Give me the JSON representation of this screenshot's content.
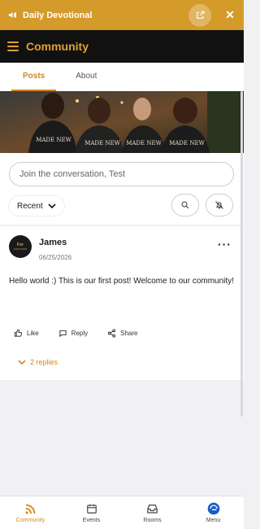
{
  "topbar": {
    "title": "Daily Devotional"
  },
  "appbar": {
    "title": "Community"
  },
  "tabs": [
    {
      "label": "Posts",
      "active": true
    },
    {
      "label": "About",
      "active": false
    }
  ],
  "hero": {
    "shirt_text": "MADE NEW"
  },
  "composer": {
    "placeholder": "Join the conversation, Test",
    "sort_label": "Recent"
  },
  "post": {
    "author": "James",
    "date": "06/25/2026",
    "avatar_text_top": "For",
    "avatar_text_mid": "FORTUVEN",
    "body": "Hello world :) This is our first post! Welcome to our community!",
    "actions": {
      "like": "Like",
      "reply": "Reply",
      "share": "Share"
    },
    "replies": "2 replies"
  },
  "bottom_nav": [
    {
      "label": "Community",
      "icon": "rss-icon",
      "active": true
    },
    {
      "label": "Events",
      "icon": "calendar-icon",
      "active": false
    },
    {
      "label": "Rooms",
      "icon": "inbox-icon",
      "active": false
    },
    {
      "label": "Menu",
      "icon": "app-logo-icon",
      "active": false
    }
  ],
  "colors": {
    "accent": "#d49a2a",
    "appbar_bg": "#111111",
    "accent_text": "#d08a1f"
  }
}
